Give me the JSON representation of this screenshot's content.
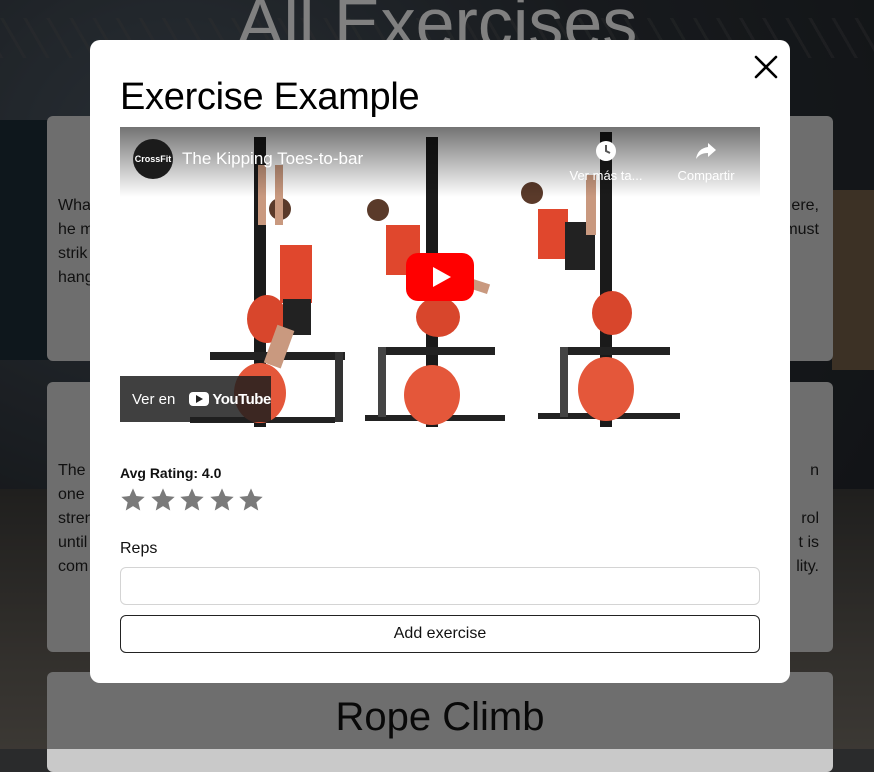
{
  "page": {
    "title": "All Exercises"
  },
  "cards": [
    {
      "lines": [
        "Wha",
        "he m",
        "strik",
        "hang"
      ],
      "right_lines": [
        "ere,",
        "must"
      ]
    },
    {
      "lines": [
        "The",
        "one",
        "stren",
        "until",
        "com"
      ],
      "right_lines": [
        "n",
        "",
        "rol",
        "t is",
        "lity."
      ]
    },
    {
      "title": "Rope Climb"
    }
  ],
  "modal": {
    "title": "Exercise Example",
    "video": {
      "channel": "CrossFit",
      "title": "The Kipping Toes-to-bar",
      "watch_later": "Ver más ta...",
      "share": "Compartir",
      "watch_on": "Ver en",
      "youtube": "YouTube"
    },
    "avg_rating_label": "Avg Rating: 4.0",
    "rating": 4.0,
    "stars_total": 5,
    "reps_label": "Reps",
    "reps_value": "",
    "add_button": "Add exercise"
  }
}
